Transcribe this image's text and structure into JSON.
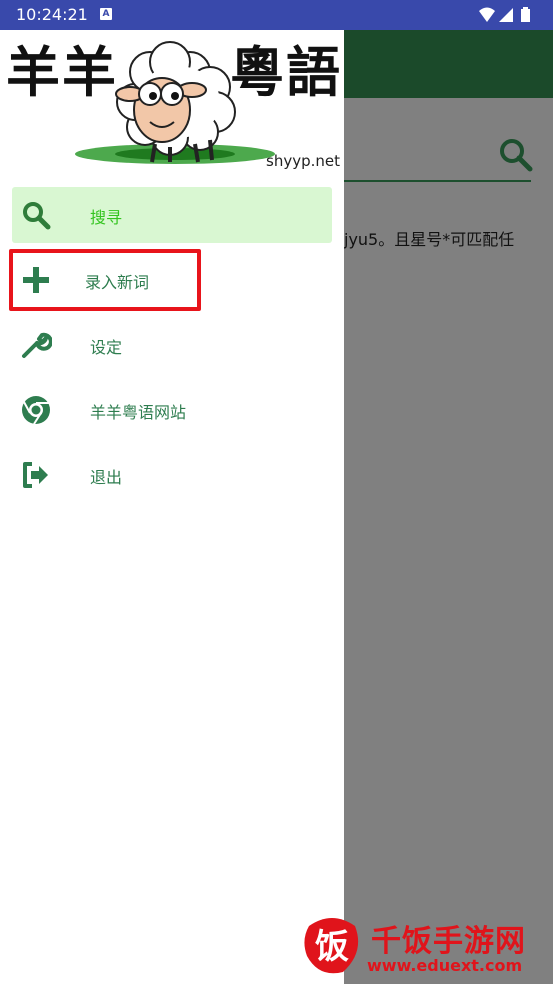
{
  "status_bar": {
    "time": "10:24:21",
    "notification_badge": "A",
    "icons": [
      "wifi-icon",
      "signal-icon",
      "battery-icon"
    ]
  },
  "app": {
    "search_hint": "jyu5。且星号*可匹配任"
  },
  "drawer": {
    "logo_left": "羊羊",
    "logo_right": "粵語",
    "site": "shyyp.net",
    "items": [
      {
        "label": "搜寻",
        "icon": "search-icon",
        "active": true
      },
      {
        "label": "录入新词",
        "icon": "plus-icon",
        "active": false
      },
      {
        "label": "设定",
        "icon": "wrench-icon",
        "active": false
      },
      {
        "label": "羊羊粤语网站",
        "icon": "chrome-icon",
        "active": false
      },
      {
        "label": "退出",
        "icon": "exit-icon",
        "active": false
      }
    ]
  },
  "watermark": {
    "title": "千饭手游网",
    "url": "www.eduext.com",
    "logo_char": "饭"
  },
  "colors": {
    "status_bar": "#3949ab",
    "accent_green": "#2e7d4f",
    "active_green": "#33c41f",
    "active_bg": "#d9f7d2",
    "highlight_red": "#e8141b"
  }
}
